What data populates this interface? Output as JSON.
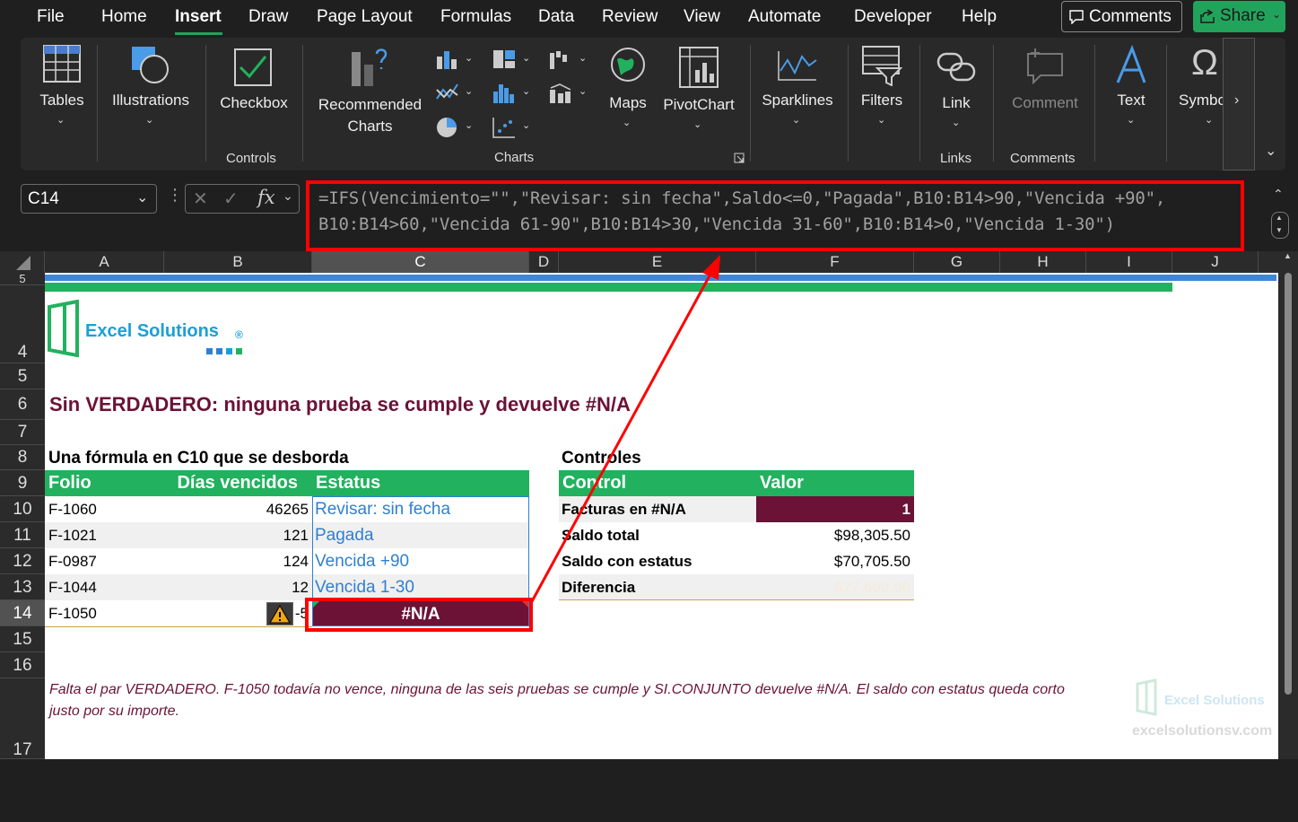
{
  "menu": {
    "items": [
      "File",
      "Home",
      "Insert",
      "Draw",
      "Page Layout",
      "Formulas",
      "Data",
      "Review",
      "View",
      "Automate",
      "Developer",
      "Help"
    ],
    "active": "Insert",
    "comments_label": "Comments",
    "share_label": "Share"
  },
  "ribbon": {
    "tables": "Tables",
    "illustrations": "Illustrations",
    "checkbox": "Checkbox",
    "controls_group": "Controls",
    "recommended_charts": "Recommended Charts",
    "charts_group": "Charts",
    "maps": "Maps",
    "pivotchart": "PivotChart",
    "sparklines": "Sparklines",
    "filters": "Filters",
    "link": "Link",
    "links_group": "Links",
    "comment": "Comment",
    "comments_group": "Comments",
    "text": "Text",
    "symbols": "Symbols"
  },
  "formula_bar": {
    "name_box": "C14",
    "fx": "fx",
    "formula": "=IFS(Vencimiento=\"\",\"Revisar: sin fecha\",Saldo<=0,\"Pagada\",B10:B14>90,\"Vencida +90\",\nB10:B14>60,\"Vencida 61-90\",B10:B14>30,\"Vencida 31-60\",B10:B14>0,\"Vencida 1-30\")"
  },
  "columns": [
    "A",
    "B",
    "C",
    "D",
    "E",
    "F",
    "G",
    "H",
    "I",
    "J"
  ],
  "rows": [
    "5",
    "4",
    "5",
    "6",
    "7",
    "8",
    "9",
    "10",
    "11",
    "12",
    "13",
    "14",
    "15",
    "16",
    "17"
  ],
  "sheet": {
    "logo_text": "Excel Solutions",
    "logo_mark": "®",
    "title": "Sin VERDADERO: ninguna prueba se cumple y devuelve #N/A",
    "table_caption": "Una fórmula en C10 que se desborda",
    "table_headers": [
      "Folio",
      "Días vencidos",
      "Estatus"
    ],
    "table_rows": [
      {
        "folio": "F-1060",
        "dias": "46265",
        "estatus": "Revisar: sin fecha"
      },
      {
        "folio": "F-1021",
        "dias": "121",
        "estatus": "Pagada"
      },
      {
        "folio": "F-0987",
        "dias": "124",
        "estatus": "Vencida +90"
      },
      {
        "folio": "F-1044",
        "dias": "12",
        "estatus": "Vencida 1-30"
      },
      {
        "folio": "F-1050",
        "dias": "-5",
        "estatus": "#N/A"
      }
    ],
    "controls_caption": "Controles",
    "controls_headers": [
      "Control",
      "Valor"
    ],
    "controls_rows": [
      {
        "label": "Facturas en #N/A",
        "value": "1"
      },
      {
        "label": "Saldo total",
        "value": "$98,305.50"
      },
      {
        "label": "Saldo con estatus",
        "value": "$70,705.50"
      },
      {
        "label": "Diferencia",
        "value": "$27,600.00"
      }
    ],
    "note": "Falta el par VERDADERO. F-1050 todavía no vence, ninguna de las seis pruebas se cumple y SI.CONJUNTO devuelve #N/A. El saldo con estatus queda corto justo por su importe.",
    "watermark_url": "excelsolutionsv.com",
    "watermark_logo": "Excel Solutions"
  },
  "colors": {
    "accent_green": "#22b15e",
    "maroon": "#6b1236",
    "link_blue": "#2f7fd1",
    "highlight_red": "#ff0000"
  }
}
